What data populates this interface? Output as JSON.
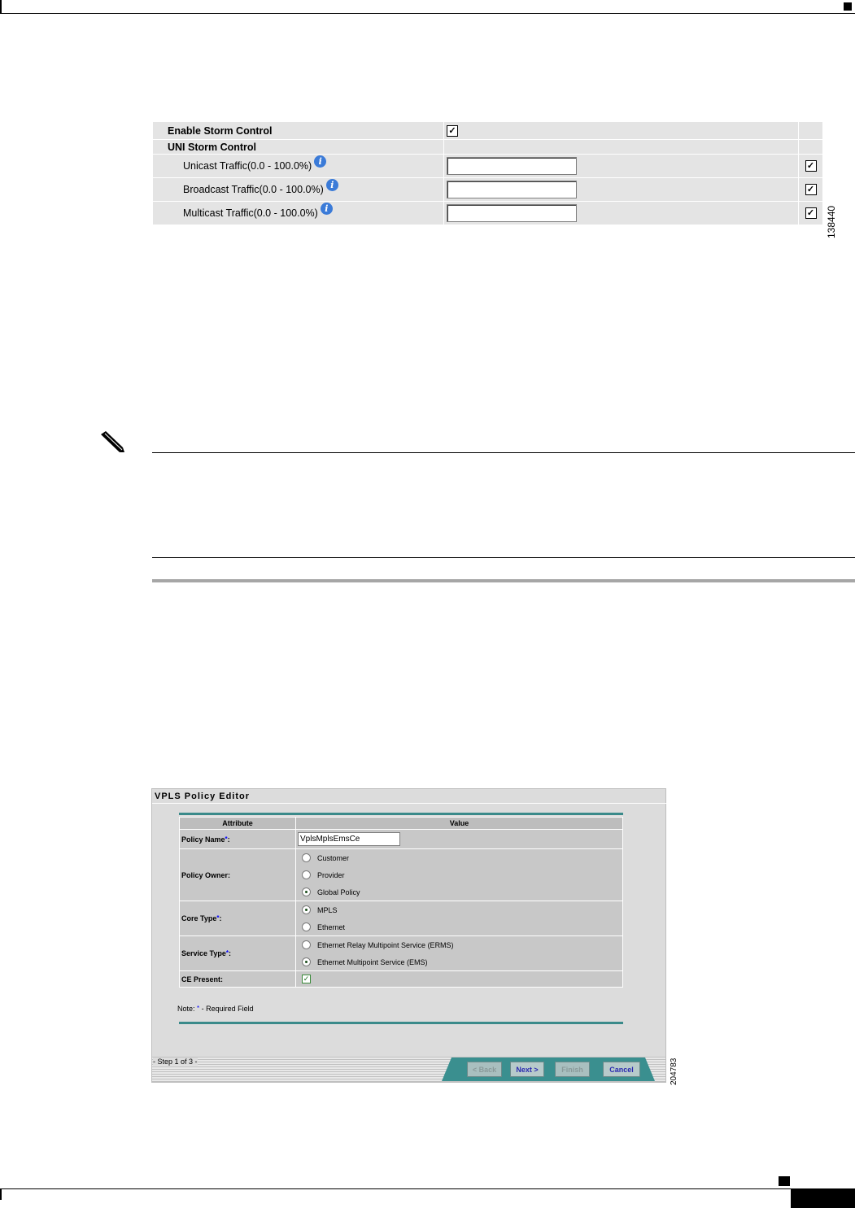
{
  "storm_figure": {
    "rows": [
      {
        "label": "Enable Storm Control",
        "checked": true
      },
      {
        "label": "UNI Storm Control"
      },
      {
        "label": "Unicast Traffic(0.0 - 100.0%)",
        "value": "",
        "override": true
      },
      {
        "label": "Broadcast Traffic(0.0 - 100.0%)",
        "value": "",
        "override": true
      },
      {
        "label": "Multicast Traffic(0.0 - 100.0%)",
        "value": "",
        "override": true
      }
    ],
    "figure_number": "138440",
    "info_glyph": "i"
  },
  "check_glyph": "✓",
  "vpls_editor": {
    "title": "VPLS Policy Editor",
    "col_attribute": "Attribute",
    "col_value": "Value",
    "policy_name_label": "Policy Name",
    "policy_name_value": "VplsMplsEmsCe",
    "policy_owner_label": "Policy Owner:",
    "policy_owner_options": [
      "Customer",
      "Provider",
      "Global Policy"
    ],
    "policy_owner_selected": "Global Policy",
    "core_type_label": "Core Type",
    "core_type_options": [
      "MPLS",
      "Ethernet"
    ],
    "core_type_selected": "MPLS",
    "service_type_label": "Service Type",
    "service_type_options": [
      "Ethernet Relay Multipoint Service (ERMS)",
      "Ethernet Multipoint Service (EMS)"
    ],
    "service_type_selected": "Ethernet Multipoint Service (EMS)",
    "ce_present_label": "CE Present:",
    "ce_present_checked": true,
    "required_marker": "*",
    "colon": ":",
    "note_prefix": "Note: ",
    "note_suffix": " - Required Field",
    "step_label": "- Step 1 of 3 -",
    "buttons": {
      "back": "< Back",
      "next": "Next >",
      "finish": "Finish",
      "cancel": "Cancel"
    },
    "figure_number": "204783"
  }
}
